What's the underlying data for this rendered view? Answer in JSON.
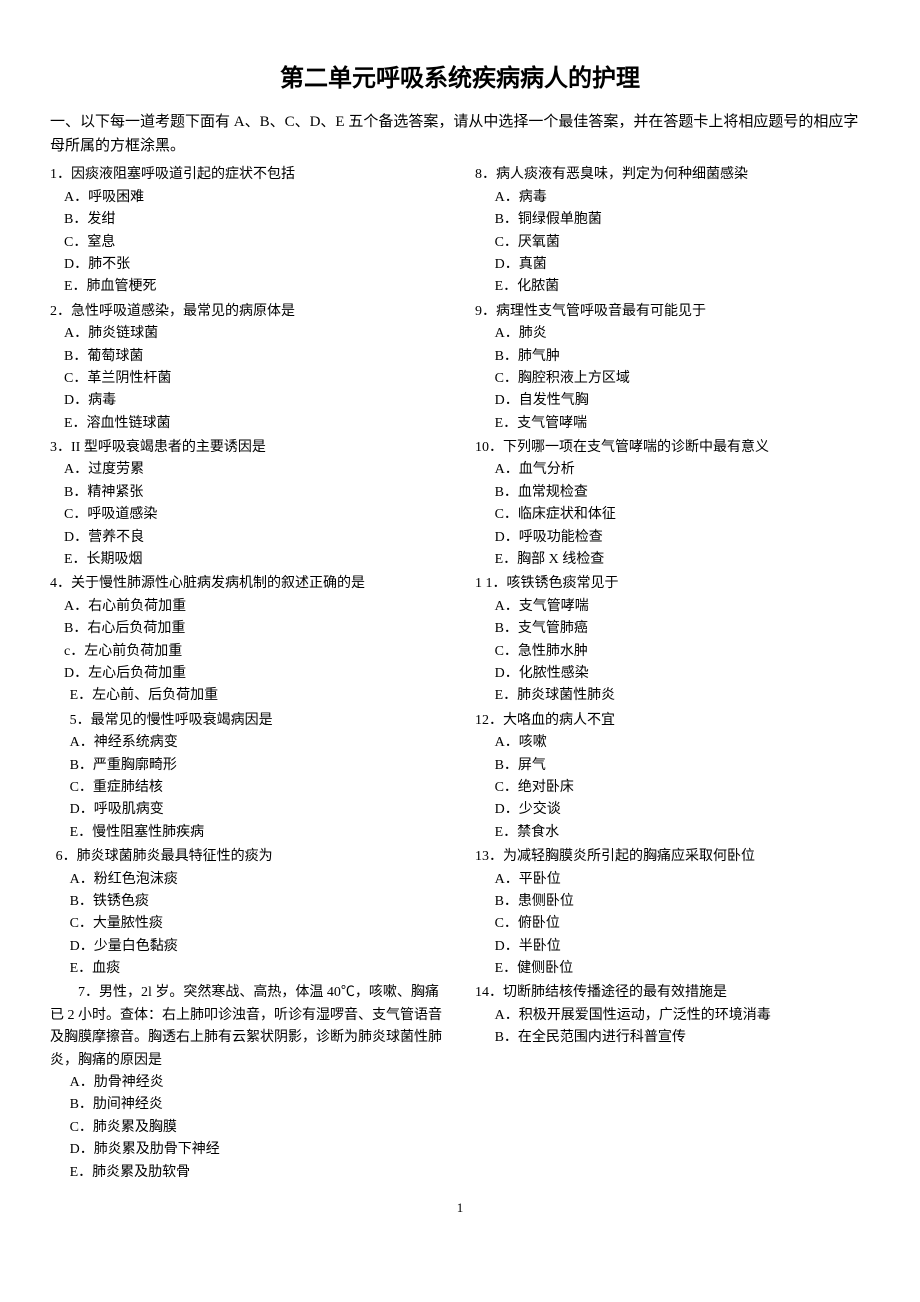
{
  "title": "第二单元呼吸系统疾病病人的护理",
  "instructions": "一、以下每一道考题下面有 A、B、C、D、E 五个备选答案，请从中选择一个最佳答案，并在答题卡上将相应题号的相应字母所属的方框涂黑。",
  "page_number": "1",
  "q1": {
    "stem": "1．因痰液阻塞呼吸道引起的症状不包括",
    "A": "A．呼吸困难",
    "B": "B．发绀",
    "C": "C．窒息",
    "D": "D．肺不张",
    "E": "E．肺血管梗死"
  },
  "q2": {
    "stem": "2．急性呼吸道感染，最常见的病原体是",
    "A": "A．肺炎链球菌",
    "B": "B．葡萄球菌",
    "C": "C．革兰阴性杆菌",
    "D": "D．病毒",
    "E": "E．溶血性链球菌"
  },
  "q3": {
    "stem": "3．II 型呼吸衰竭患者的主要诱因是",
    "A": "A．过度劳累",
    "B": "B．精神紧张",
    "C": "C．呼吸道感染",
    "D": "D．营养不良",
    "E": "E．长期吸烟"
  },
  "q4": {
    "stem": "4．关于慢性肺源性心脏病发病机制的叙述正确的是",
    "A": "A．右心前负荷加重",
    "B": "B．右心后负荷加重",
    "C": "c．左心前负荷加重",
    "D": "D．左心后负荷加重",
    "E": "E．左心前、后负荷加重"
  },
  "q5": {
    "stem": "5．最常见的慢性呼吸衰竭病因是",
    "A": "A．神经系统病变",
    "B": "B．严重胸廓畸形",
    "C": "C．重症肺结核",
    "D": "D．呼吸肌病变",
    "E": "E．慢性阻塞性肺疾病"
  },
  "q6": {
    "stem": "6．肺炎球菌肺炎最具特征性的痰为",
    "A": "A．粉红色泡沫痰",
    "B": "B．铁锈色痰",
    "C": "C．大量脓性痰",
    "D": "D．少量白色黏痰",
    "E": "E．血痰"
  },
  "q7": {
    "stem": "　　7．男性，2l 岁。突然寒战、高热，体温 40℃，咳嗽、胸痛已 2 小时。查体：右上肺叩诊浊音，听诊有湿啰音、支气管语音及胸膜摩擦音。胸透右上肺有云絮状阴影，诊断为肺炎球菌性肺炎，胸痛的原因是",
    "A": "A．肋骨神经炎",
    "B": "B．肋间神经炎",
    "C": "C．肺炎累及胸膜",
    "D": "D．肺炎累及肋骨下神经",
    "E": "E．肺炎累及肋软骨"
  },
  "q8": {
    "stem": "8．病人痰液有恶臭味，判定为何种细菌感染",
    "A": "A．病毒",
    "B": "B．铜绿假单胞菌",
    "C": "C．厌氧菌",
    "D": "D．真菌",
    "E": "E．化脓菌"
  },
  "q9": {
    "stem": "9．病理性支气管呼吸音最有可能见于",
    "A": "A．肺炎",
    "B": "B．肺气肿",
    "C": "C．胸腔积液上方区域",
    "D": "D．自发性气胸",
    "E": "E．支气管哮喘"
  },
  "q10": {
    "stem": "10．下列哪一项在支气管哮喘的诊断中最有意义",
    "A": "A．血气分析",
    "B": "B．血常规检查",
    "C": "C．临床症状和体征",
    "D": "D．呼吸功能检查",
    "E": "E．胸部 X 线检查"
  },
  "q11": {
    "stem": "1 1．咳铁锈色痰常见于",
    "A": "A．支气管哮喘",
    "B": "B．支气管肺癌",
    "C": "C．急性肺水肿",
    "D": "D．化脓性感染",
    "E": "E．肺炎球菌性肺炎"
  },
  "q12": {
    "stem": "12．大咯血的病人不宜",
    "A": "A．咳嗽",
    "B": "B．屏气",
    "C": "C．绝对卧床",
    "D": "D．少交谈",
    "E": "E．禁食水"
  },
  "q13": {
    "stem": "13．为减轻胸膜炎所引起的胸痛应采取何卧位",
    "A": "A．平卧位",
    "B": "B．患侧卧位",
    "C": "C．俯卧位",
    "D": "D．半卧位",
    "E": "E．健侧卧位"
  },
  "q14": {
    "stem": "14．切断肺结核传播途径的最有效措施是",
    "A": "A．积极开展爱国性运动，广泛性的环境消毒",
    "B": "B．在全民范围内进行科普宣传"
  }
}
